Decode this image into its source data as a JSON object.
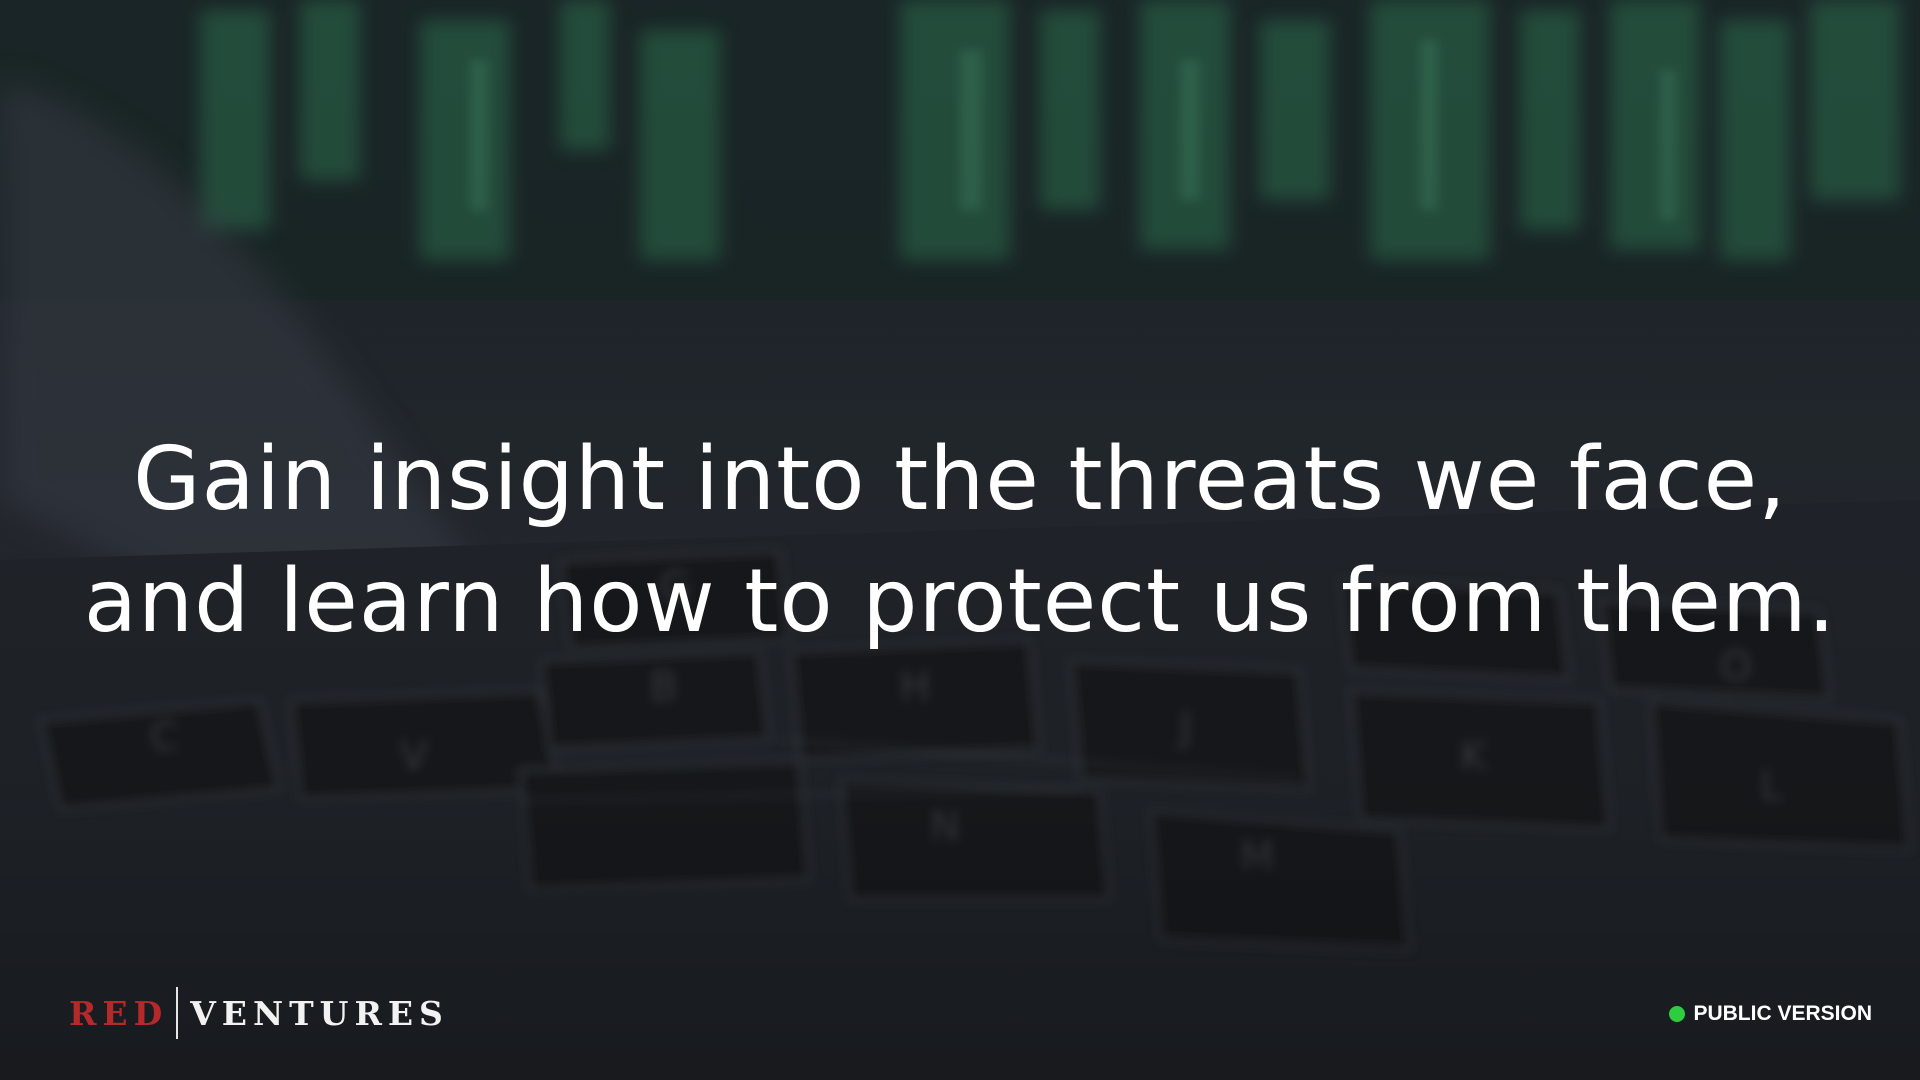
{
  "slide": {
    "headline_line1": "Gain insight into the threats we face,",
    "headline_line2": "and learn how to protect us from them."
  },
  "footer": {
    "logo_left": "RED",
    "logo_right": "VENTURES",
    "status_label": "PUBLIC VERSION",
    "status_color": "#2ecc40"
  },
  "background": {
    "description_icon": "keyboard-photo",
    "accent_color": "#3a8f66"
  }
}
